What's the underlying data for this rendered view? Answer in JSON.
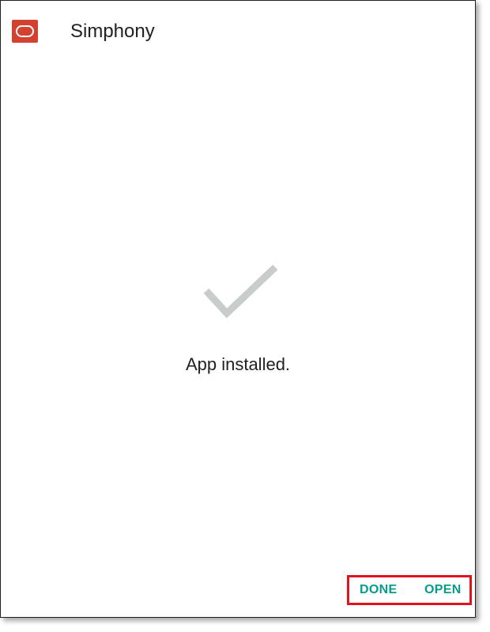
{
  "app": {
    "name": "Simphony",
    "icon": "oracle-logo-icon",
    "icon_color": "#d3412f"
  },
  "main": {
    "status_icon": "checkmark-icon",
    "status_icon_color": "#c8ccca",
    "status_text": "App installed."
  },
  "actions": {
    "done_label": "DONE",
    "open_label": "OPEN",
    "label_color": "#079c8a",
    "highlight_color": "#e0131e"
  }
}
